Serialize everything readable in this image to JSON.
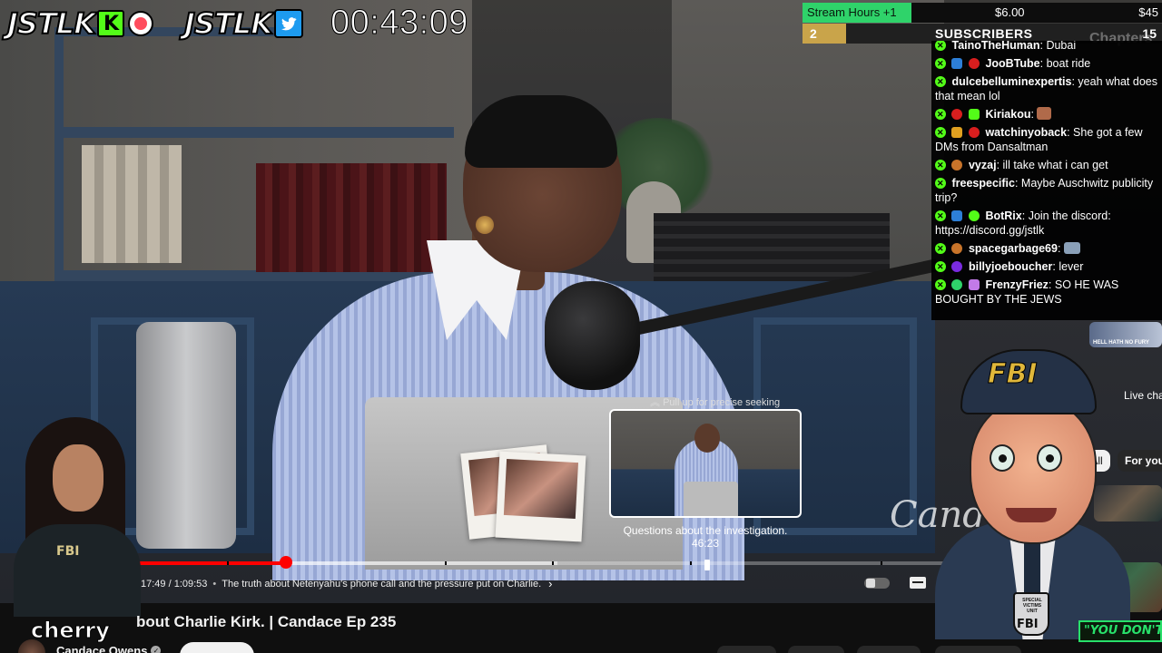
{
  "overlay": {
    "brand_left": "JSTLK",
    "kick_letter": "K",
    "brand_right": "JSTLK",
    "timer": "00:43:09"
  },
  "subathon": {
    "label": "Stream Hours +1",
    "price_mid": "$6.00",
    "price_right": "$45",
    "sub_goal_count": "2",
    "subs_title": "SUBSCRIBERS",
    "subs_total": "15",
    "chapters_ghost": "Chapters"
  },
  "chat": {
    "messages": [
      {
        "user": "TainoTheHuman",
        "text": "Dubai"
      },
      {
        "user": "JooBTube",
        "text": "boat ride"
      },
      {
        "user": "dulcebelluminexpertis",
        "text": "yeah what does that mean lol"
      },
      {
        "user": "Kiriakou",
        "text": ""
      },
      {
        "user": "watchinyoback",
        "text": "She got a few DMs from Dansaltman"
      },
      {
        "user": "vyzaj",
        "text": "ill take what i can get"
      },
      {
        "user": "freespecific",
        "text": "Maybe Auschwitz publicity trip?"
      },
      {
        "user": "BotRix",
        "text": "Join the discord: https://discord.gg/jstlk"
      },
      {
        "user": "spacegarbage69",
        "text": ""
      },
      {
        "user": "billyjoeboucher",
        "text": "lever"
      },
      {
        "user": "FrenzyFriez",
        "text": "SO HE WAS BOUGHT BY THE JEWS"
      }
    ]
  },
  "preview": {
    "hint": "Pull up for precise seeking",
    "title": "Questions about the investigation.",
    "time": "46:23"
  },
  "player": {
    "time": "17:49 / 1:09:53",
    "separator": "•",
    "chapter": "The truth about Netenyahu's phone call and the pressure put on Charlie.",
    "played_fraction": 0.16,
    "buffered_fraction": 0.45,
    "hover_fraction": 0.61
  },
  "streamer": {
    "name": "cherry",
    "mascot_cap": "FBI",
    "mascot_badge": "FBI",
    "mascot_badge_small": "SPECIAL VICTIMS UNIT",
    "signature": "Cand"
  },
  "side": {
    "thumb_caption": "HELL HATH NO FURY",
    "live_chat": "Live cha",
    "chip_all": "All",
    "chip_foryou": "For you",
    "green_caption": "\"YOU DON'T K"
  },
  "below": {
    "video_title": "bout Charlie Kirk. | Candace Ep 235",
    "channel_name": "Candace Owens"
  },
  "colors": {
    "kick_green": "#53fc18",
    "progress_red": "#ff0000",
    "subathon_green": "#2fd36a",
    "twitter_blue": "#1d9bf0"
  }
}
